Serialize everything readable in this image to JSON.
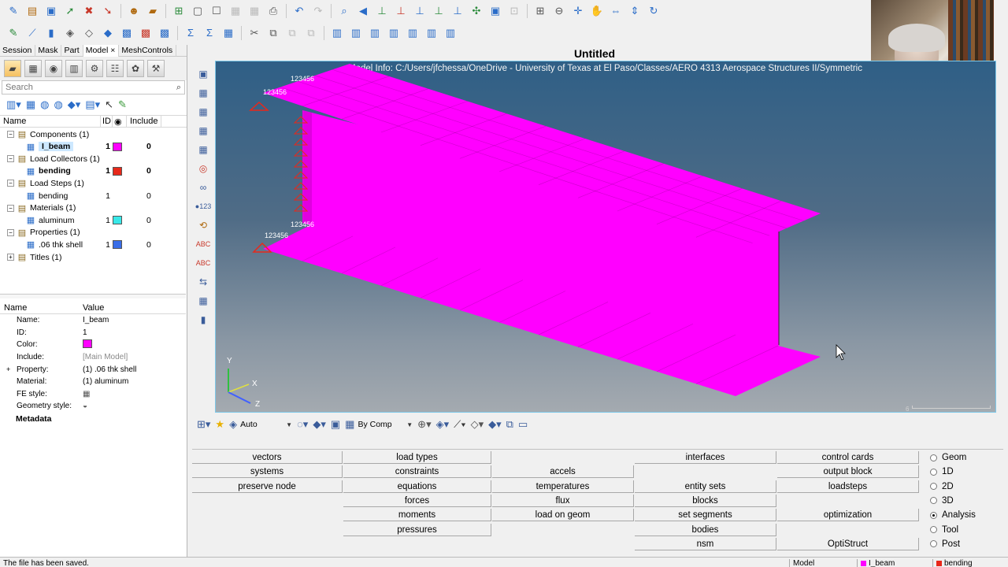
{
  "window": {
    "title": "Untitled"
  },
  "toolbar1": {
    "icons": [
      "open-model-icon",
      "import-icon",
      "save-icon",
      "export-icon",
      "delete-icon",
      "publish-icon",
      "user-icon",
      "folder-icon",
      "add-panel-icon",
      "blank-icon",
      "frame-icon",
      "disabled-icon",
      "disabled-icon",
      "screenshot-icon",
      "undo-icon",
      "redo-icon",
      "zoom-icon",
      "arrow-left-icon",
      "axis-xy-icon",
      "axis-yz-icon",
      "axis-zx-icon",
      "axis-iso1-icon",
      "axis-iso2-icon",
      "axis-iso3-icon",
      "capture-icon",
      "disabled-icon",
      "zoom-box-icon",
      "zoom-out-icon",
      "pan-icon",
      "hand-icon",
      "rotate-h-icon",
      "rotate-v-icon",
      "spin-icon"
    ]
  },
  "toolbar2": {
    "icons": [
      "pencil-icon",
      "ruler-icon",
      "cylinder-icon",
      "cube-icon",
      "cube-wire-icon",
      "cube-solid-icon",
      "mesh-icon",
      "mesh-red-icon",
      "sigma-icon",
      "sigma-x-icon",
      "calculator-icon",
      "cut-icon",
      "copy-icon",
      "disabled-icon",
      "disabled-icon",
      "view1-icon",
      "view2-icon",
      "view3-icon",
      "view4-icon",
      "view5-icon",
      "view6-icon",
      "view7-icon"
    ]
  },
  "browser": {
    "tabs": [
      "Session",
      "Mask",
      "Part",
      "Model",
      "MeshControls"
    ],
    "active_tab_close": "×",
    "search_placeholder": "Search",
    "columns": {
      "name": "Name",
      "id": "ID",
      "include": "Include"
    },
    "tree": [
      {
        "label": "Components (1)",
        "level": 0,
        "exp": "−"
      },
      {
        "label": "I_beam",
        "level": 1,
        "id": "1",
        "color": "#ff00ff",
        "include": "0",
        "selected": true,
        "bold": true
      },
      {
        "label": "Load Collectors (1)",
        "level": 0,
        "exp": "−"
      },
      {
        "label": "bending",
        "level": 1,
        "id": "1",
        "color": "#e8281a",
        "include": "0",
        "bold": true
      },
      {
        "label": "Load Steps (1)",
        "level": 0,
        "exp": "−"
      },
      {
        "label": "bending",
        "level": 1,
        "id": "1",
        "include": "0"
      },
      {
        "label": "Materials (1)",
        "level": 0,
        "exp": "−"
      },
      {
        "label": "aluminum",
        "level": 1,
        "id": "1",
        "color": "#38e8e8",
        "include": "0"
      },
      {
        "label": "Properties (1)",
        "level": 0,
        "exp": "−"
      },
      {
        "label": ".06 thk shell",
        "level": 1,
        "id": "1",
        "color": "#3a6ee8",
        "include": "0"
      },
      {
        "label": "Titles (1)",
        "level": 0,
        "exp": "+"
      }
    ]
  },
  "entity_editor": {
    "columns": {
      "name": "Name",
      "value": "Value"
    },
    "rows": [
      {
        "key": "Name:",
        "value": "I_beam"
      },
      {
        "key": "ID:",
        "value": "1"
      },
      {
        "key": "Color:",
        "value": "",
        "swatch": "#ff00ff"
      },
      {
        "key": "Include:",
        "value": "[Main Model]",
        "gray": true
      },
      {
        "key": "Property:",
        "value": "(1) .06 thk shell",
        "exp": "+"
      },
      {
        "key": "Material:",
        "value": "(1) aluminum"
      },
      {
        "key": "FE style:",
        "value": "",
        "icon": "mesh-style-icon"
      },
      {
        "key": "Geometry style:",
        "value": "",
        "icon": "geom-style-icon"
      },
      {
        "key": "Metadata",
        "value": "",
        "bold": true
      }
    ]
  },
  "viewport": {
    "model_info": "Model Info: C:/Users/jfchessa/OneDrive - University of Texas at El Paso/Classes/AERO 4313 Aerospace Structures II/Symmetric",
    "dof_label": "123456",
    "axis": {
      "x": "X",
      "y": "Y",
      "z": "Z"
    },
    "scale_value": "6",
    "colors": {
      "beam": "#ff00ff",
      "constraint": "#e8281a",
      "bg_top": "#2f5f86",
      "bg_bottom": "#a4aab0"
    }
  },
  "viewbar": {
    "auto_label": "Auto",
    "bycomp_label": "By Comp"
  },
  "panel": {
    "col1": [
      "vectors",
      "systems",
      "preserve node"
    ],
    "col2": [
      "load types",
      "constraints",
      "equations",
      "forces",
      "moments",
      "pressures"
    ],
    "col3": [
      "",
      "accels",
      "temperatures",
      "flux",
      "load on geom"
    ],
    "col4": [
      "interfaces",
      "",
      "entity sets",
      "blocks",
      "set segments",
      "bodies",
      "nsm"
    ],
    "col5": [
      "control cards",
      "output block",
      "loadsteps",
      "",
      "optimization",
      "",
      "OptiStruct"
    ],
    "radios": [
      {
        "label": "Geom",
        "on": false
      },
      {
        "label": "1D",
        "on": false
      },
      {
        "label": "2D",
        "on": false
      },
      {
        "label": "3D",
        "on": false
      },
      {
        "label": "Analysis",
        "on": true
      },
      {
        "label": "Tool",
        "on": false
      },
      {
        "label": "Post",
        "on": false
      }
    ]
  },
  "status": {
    "message": "The file has been saved.",
    "model": "Model",
    "component": "I_beam",
    "loadcol": "bending",
    "component_color": "#ff00ff",
    "loadcol_color": "#e8281a"
  }
}
